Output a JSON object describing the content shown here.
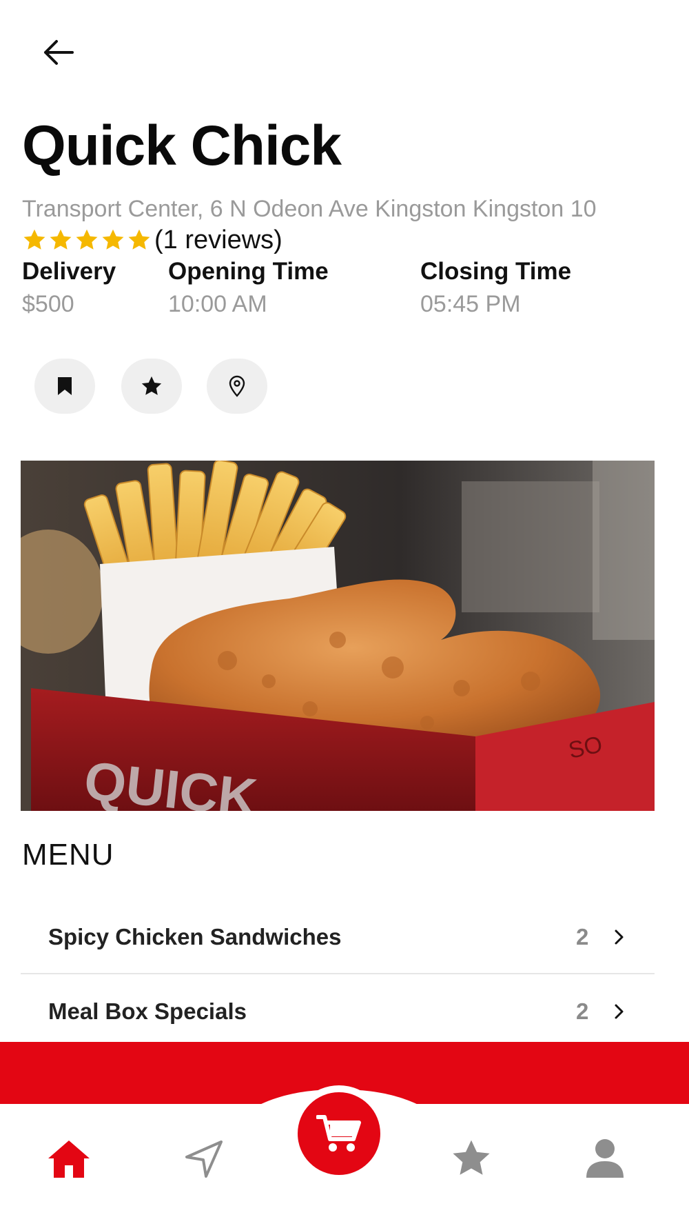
{
  "header": {
    "back_icon": "arrow-left-icon"
  },
  "restaurant": {
    "name": "Quick Chick",
    "address": "Transport Center, 6 N Odeon Ave Kingston Kingston 10",
    "rating": 5,
    "rating_max": 5,
    "reviews_text": "(1 reviews)"
  },
  "info": {
    "delivery_label": "Delivery",
    "delivery_value": "$500",
    "opening_label": "Opening Time",
    "opening_value": "10:00 AM",
    "closing_label": "Closing Time",
    "closing_value": "05:45 PM"
  },
  "actions": [
    {
      "icon": "bookmark-icon"
    },
    {
      "icon": "star-icon"
    },
    {
      "icon": "map-pin-icon"
    }
  ],
  "hero": {
    "box_text": "QUICK",
    "corner_text": "SO"
  },
  "menu": {
    "heading": "MENU",
    "items": [
      {
        "name": "Spicy Chicken Sandwiches",
        "count": "2"
      },
      {
        "name": "Meal Box Specials",
        "count": "2"
      }
    ]
  },
  "tabbar": {
    "tabs": [
      {
        "icon": "home-icon",
        "active": true
      },
      {
        "icon": "navigation-icon",
        "active": false
      },
      {
        "icon": "cart-icon",
        "active": false
      },
      {
        "icon": "star-icon",
        "active": false
      },
      {
        "icon": "user-icon",
        "active": false
      }
    ]
  },
  "colors": {
    "accent": "#e30613",
    "muted_text": "#9a9a9a",
    "star": "#f5b800",
    "icon_gray": "#8e8e8e"
  }
}
